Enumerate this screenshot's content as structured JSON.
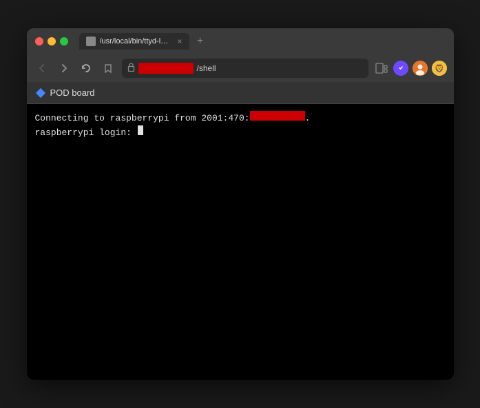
{
  "browser": {
    "tab": {
      "title": "/usr/local/bin/ttyd-login (raspber...",
      "close_label": "×",
      "new_tab_label": "+"
    },
    "nav": {
      "back_label": "‹",
      "forward_label": "›",
      "reload_label": "↻",
      "bookmark_label": "🔖",
      "url_suffix": "/shell",
      "lock_icon": "🔒"
    },
    "bookmark_bar": {
      "label": "POD board"
    }
  },
  "terminal": {
    "line1_prefix": "Connecting to raspberrypi from 2001:470:",
    "line1_suffix": ".",
    "line2": "raspberrypi login: "
  },
  "icons": {
    "page_display": "⧉",
    "brave_shield": "B",
    "profile": "👤",
    "bat_reward": "🦁"
  }
}
